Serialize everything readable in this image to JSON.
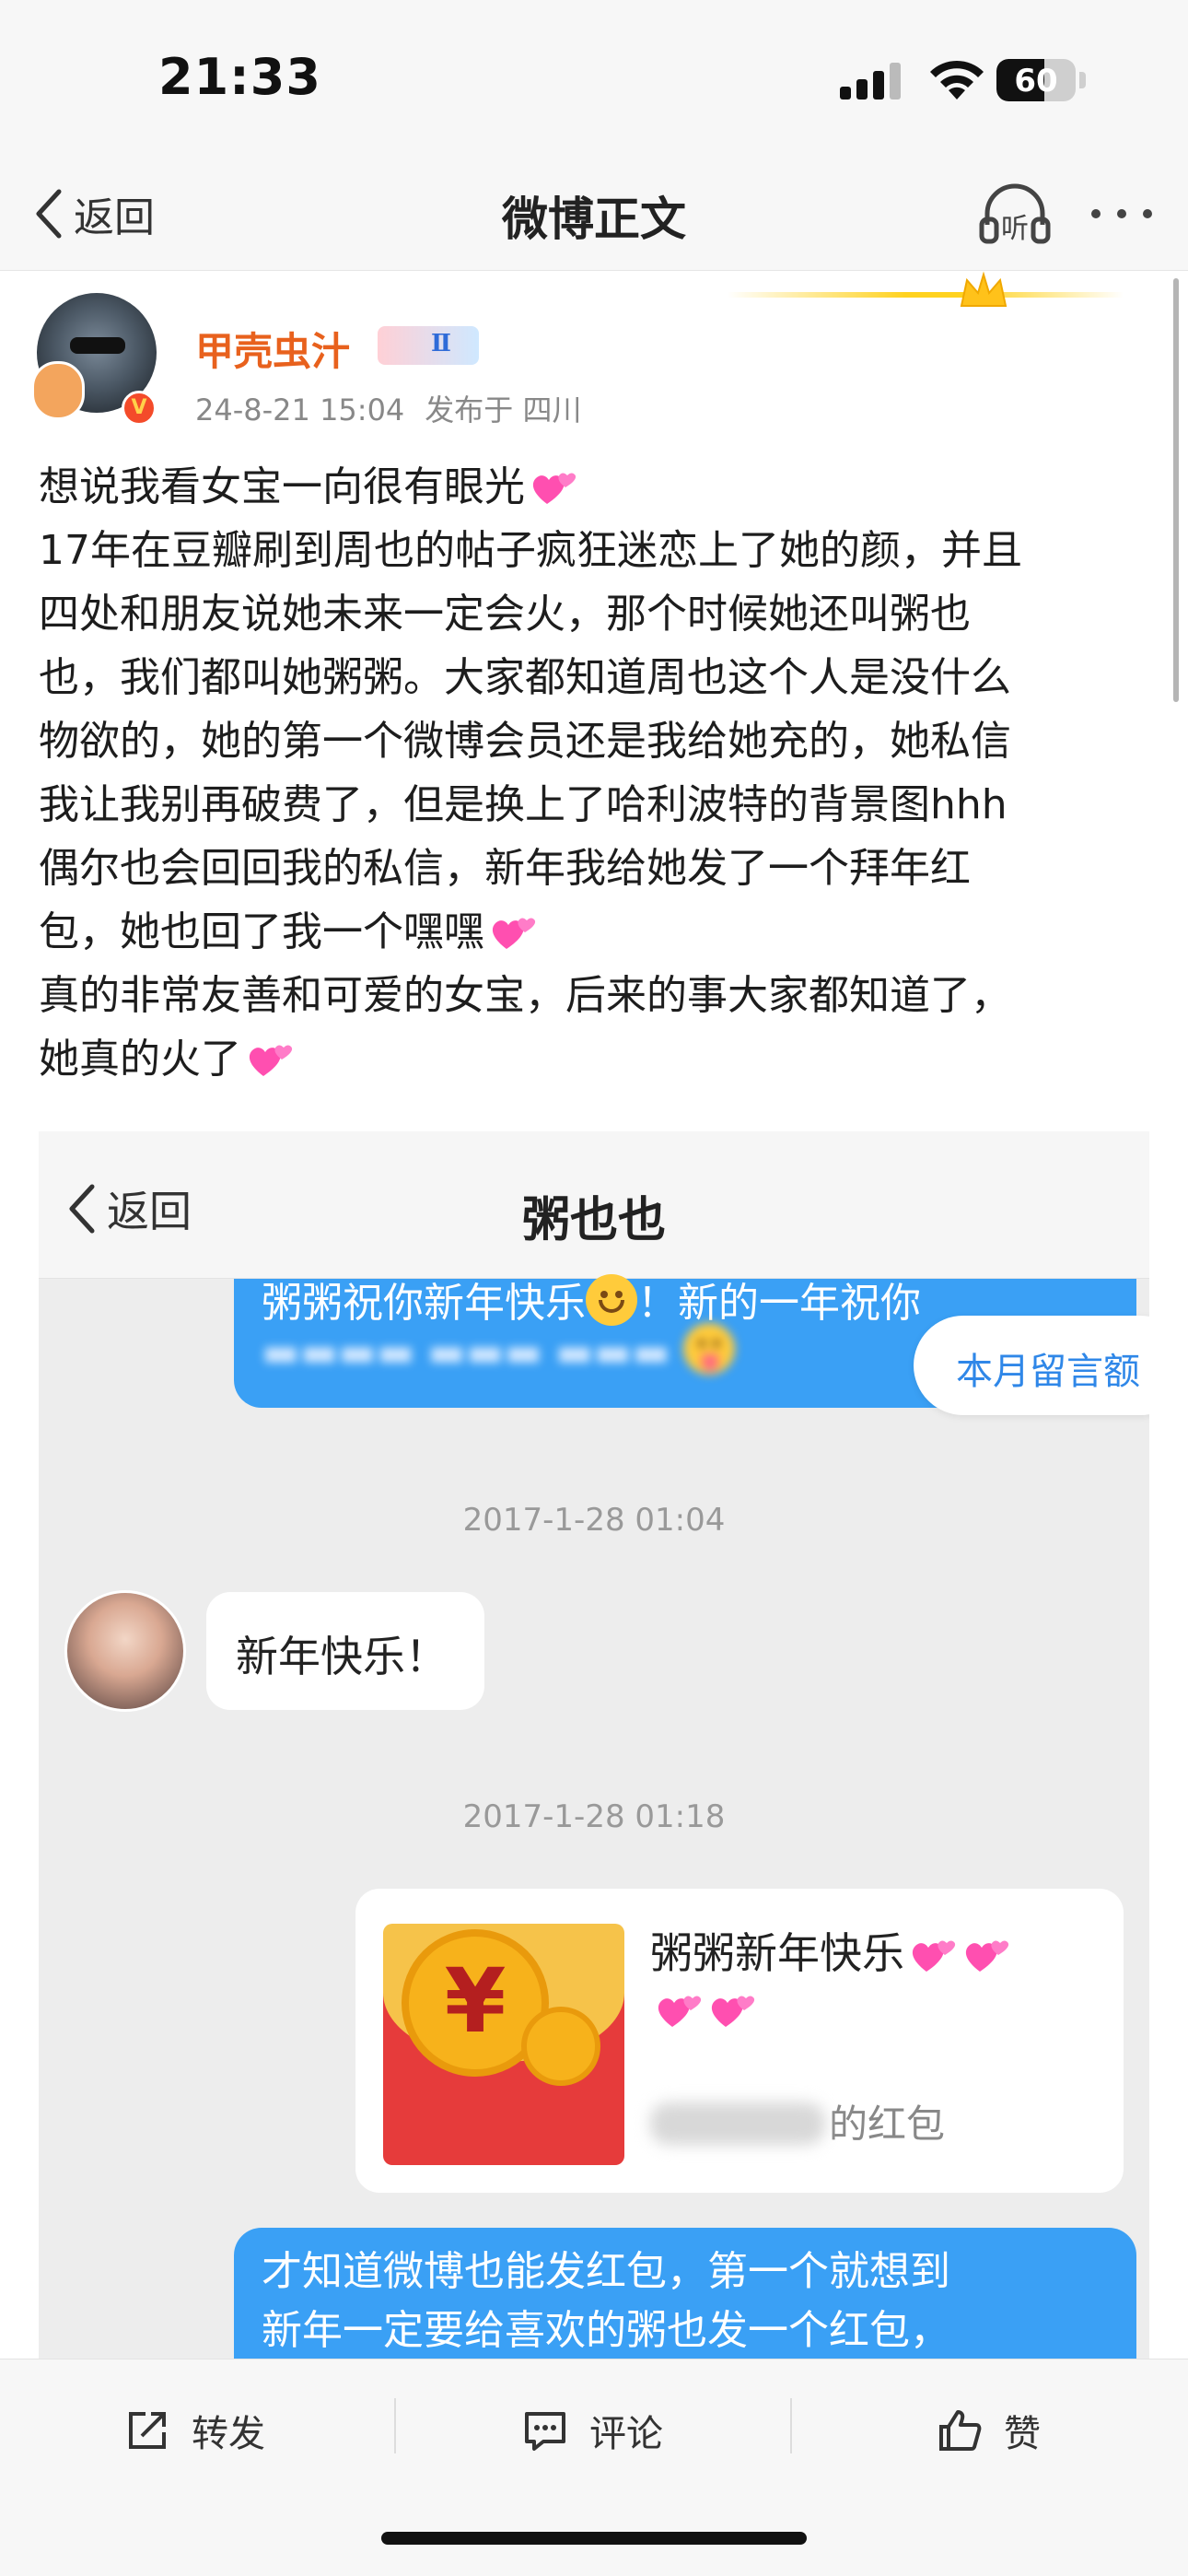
{
  "status_bar": {
    "time": "21:33",
    "battery": "60",
    "battery_level": 0.6
  },
  "nav": {
    "back_label": "返回",
    "title": "微博正文"
  },
  "post": {
    "author": "甲壳虫汁",
    "date": "24-8-21 15:04",
    "location": "发布于 四川",
    "lines": [
      "想说我看女宝一向很有眼光",
      "17年在豆瓣刷到周也的帖子疯狂迷恋上了她的颜，并且",
      "四处和朋友说她未来一定会火，那个时候她还叫粥也",
      "也，我们都叫她粥粥。大家都知道周也这个人是没什么",
      "物欲的，她的第一个微博会员还是我给她充的，她私信",
      "我让我别再破费了，但是换上了哈利波特的背景图hhh",
      "偶尔也会回回我的私信，新年我给她发了一个拜年红",
      "包，她也回了我一个嘿嘿",
      "真的非常友善和可爱的女宝，后来的事大家都知道了，",
      "她真的火了"
    ]
  },
  "embedded": {
    "back_label": "返回",
    "title": "粥也也",
    "top_bubble_line1": "粥粥祝你新年快乐",
    "top_bubble_line1_tail": "！新的一年祝你",
    "pill_label": "本月留言额",
    "timestamp1": "2017-1-28 01:04",
    "reply_text": "新年快乐！",
    "timestamp2": "2017-1-28 01:18",
    "redpacket_text": "粥粥新年快乐",
    "redpacket_sub": "的红包",
    "bottom_bubble_line1": "才知道微博也能发红包，第一个就想到",
    "bottom_bubble_line2": "新年一定要给喜欢的粥也发一个红包，"
  },
  "toolbar": {
    "repost": "转发",
    "comment": "评论",
    "like": "赞"
  },
  "colors": {
    "author": "#e8611d",
    "bubble_blue": "#3aa0f5",
    "link_blue": "#2f87e8"
  }
}
